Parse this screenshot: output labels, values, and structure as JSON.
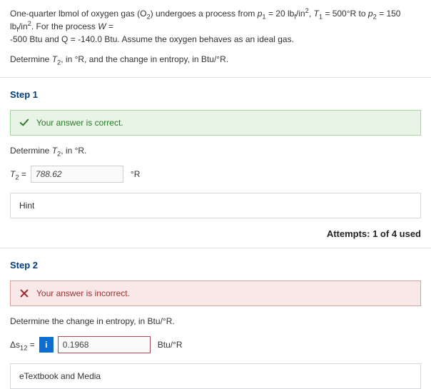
{
  "problem": {
    "line1_pre": "One-quarter lbmol of oxygen gas (O",
    "line1_sub1": "2",
    "line1_mid1": ") undergoes a process from ",
    "p1_var": "p",
    "p1_sub": "1",
    "eq20": " = 20 lb",
    "f_sub": "f",
    "per_in2": "/in",
    "sq": "2",
    "comma_T1": ", ",
    "T1_var": "T",
    "T1_sub": "1",
    "eq500R": " = 500°R to ",
    "p2_var": "p",
    "p2_sub": "2",
    "eq150": " = 150 lb",
    "tail1": ". For the process ",
    "W_sym": "W",
    "eq_end": " = ",
    "line2": "-500 Btu and Q = -140.0 Btu. Assume the oxygen behaves as an ideal gas.",
    "askline_pre": "Determine ",
    "T2_var": "T",
    "T2_sub": "2",
    "askline_mid": ", in °R, and the change in entropy, in Btu/°R."
  },
  "step1": {
    "heading": "Step 1",
    "feedback": "Your answer is correct.",
    "prompt_pre": "Determine ",
    "prompt_T": "T",
    "prompt_sub": "2",
    "prompt_post": ", in °R.",
    "lhs_T": "T",
    "lhs_sub": "2",
    "lhs_eq": " = ",
    "value": "788.62",
    "unit": "°R",
    "hint_label": "Hint",
    "attempts": "Attempts: 1 of 4 used"
  },
  "step2": {
    "heading": "Step 2",
    "feedback": "Your answer is incorrect.",
    "prompt": "Determine the change in entropy, in Btu/°R.",
    "lhs_delta": "Δs",
    "lhs_sub": "12",
    "lhs_eq": "  =  ",
    "info": "i",
    "value": "0.1968",
    "unit": "Btu/°R",
    "media_label": "eTextbook and Media"
  }
}
